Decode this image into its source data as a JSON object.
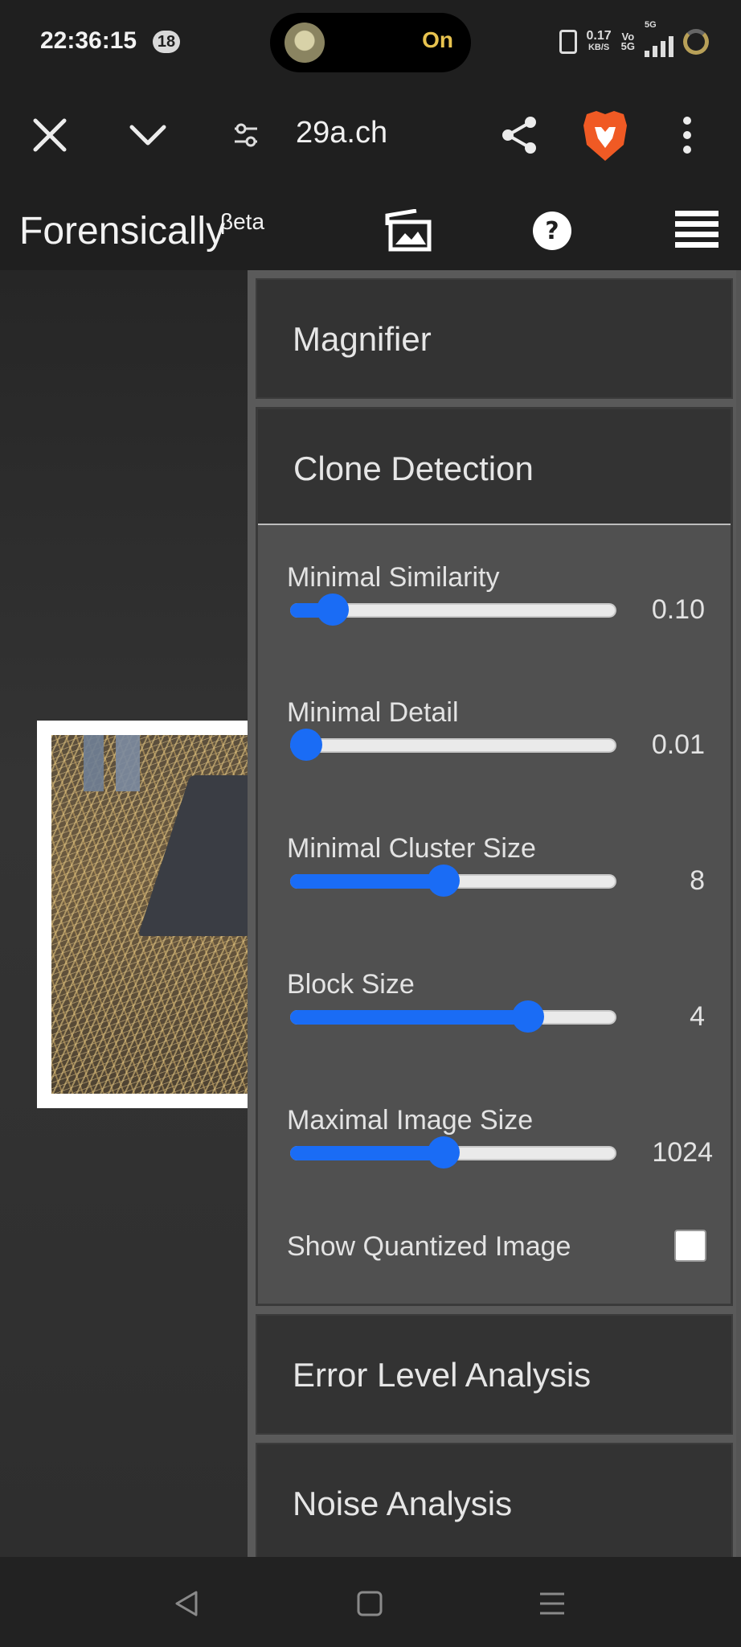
{
  "status_bar": {
    "time": "22:36:15",
    "notification_count": "18",
    "torch_status": "On",
    "speed_value": "0.17",
    "speed_unit": "KB/S",
    "volte_top": "Vo",
    "volte_bottom": "5G",
    "network_type": "5G"
  },
  "browser": {
    "url": "29a.ch"
  },
  "app": {
    "title": "Forensically",
    "beta": "βeta"
  },
  "panel": {
    "magnifier": "Magnifier",
    "clone_detection": "Clone Detection",
    "error_level_analysis": "Error Level Analysis",
    "noise_analysis": "Noise Analysis",
    "controls": [
      {
        "label": "Minimal Similarity",
        "value": "0.10",
        "fraction": 0.13
      },
      {
        "label": "Minimal Detail",
        "value": "0.01",
        "fraction": 0.05
      },
      {
        "label": "Minimal Cluster Size",
        "value": "8",
        "fraction": 0.47
      },
      {
        "label": "Block Size",
        "value": "4",
        "fraction": 0.73
      },
      {
        "label": "Maximal Image Size",
        "value": "1024",
        "fraction": 0.47
      }
    ],
    "show_quantized_label": "Show Quantized Image",
    "show_quantized_checked": false
  },
  "colors": {
    "accent": "#1a6cf5",
    "panel_bg": "#505050",
    "section_bg": "#333333"
  }
}
